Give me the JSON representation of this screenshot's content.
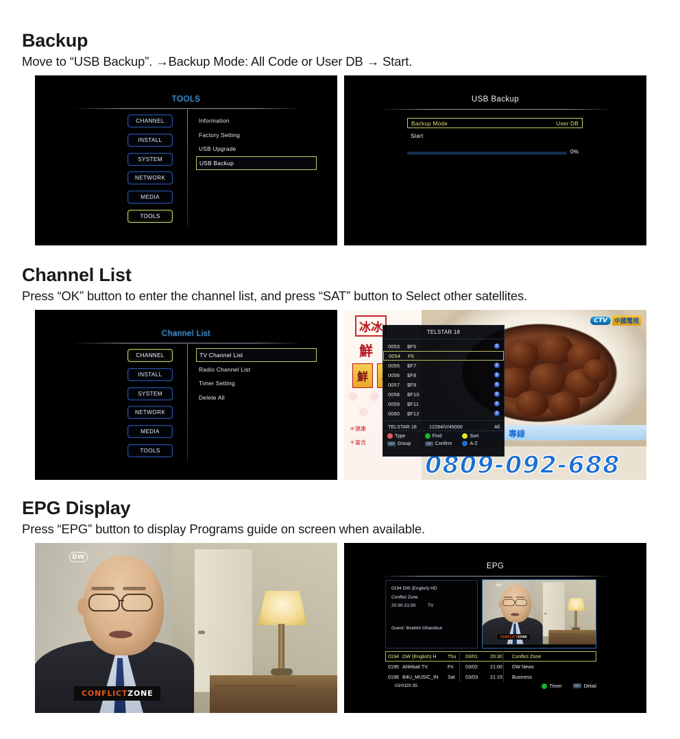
{
  "sections": [
    {
      "title": "Backup",
      "subtitle": "Move to “USB Backup”. →Backup Mode: All Code or User DB →  Start."
    },
    {
      "title": "Channel List",
      "subtitle": "Press “OK” button to enter the channel list, and press “SAT” button to Select other satellites."
    },
    {
      "title": "EPG Display",
      "subtitle": "Press “EPG” button to display Programs guide on screen when available."
    }
  ],
  "tools_menu": {
    "title": "TOOLS",
    "sidebar": [
      "CHANNEL",
      "INSTALL",
      "SYSTEM",
      "NETWORK",
      "MEDIA",
      "TOOLS"
    ],
    "selected_sidebar": "TOOLS",
    "options": [
      "Information",
      "Factory Setting",
      "USB Upgrade",
      "USB Backup"
    ],
    "selected_option": "USB Backup"
  },
  "usb_backup": {
    "title": "USB Backup",
    "mode_label": "Backup Mode",
    "mode_value": "User DB",
    "start_label": "Start",
    "progress_text": "0%",
    "progress_percent": 0
  },
  "channel_menu": {
    "title": "Channel List",
    "sidebar": [
      "CHANNEL",
      "INSTALL",
      "SYSTEM",
      "NETWORK",
      "MEDIA",
      "TOOLS"
    ],
    "selected_sidebar": "CHANNEL",
    "options": [
      "TV Channel List",
      "Radio Channel List",
      "Timer Setting",
      "Delete All"
    ],
    "selected_option": "TV Channel List"
  },
  "channel_list": {
    "header": "TELSTAR 18",
    "rows": [
      {
        "num": "0053",
        "name": "$F5",
        "locked": true,
        "selected": false
      },
      {
        "num": "0054",
        "name": "F6",
        "locked": false,
        "selected": true
      },
      {
        "num": "0055",
        "name": "$F7",
        "locked": true,
        "selected": false
      },
      {
        "num": "0056",
        "name": "$F8",
        "locked": true,
        "selected": false
      },
      {
        "num": "0057",
        "name": "$F9",
        "locked": true,
        "selected": false
      },
      {
        "num": "0058",
        "name": "$F10",
        "locked": true,
        "selected": false
      },
      {
        "num": "0059",
        "name": "$F11",
        "locked": true,
        "selected": false
      },
      {
        "num": "0060",
        "name": "$F12",
        "locked": true,
        "selected": false
      }
    ],
    "footer_satellite": "TELSTAR 18",
    "footer_tp": "12294/V/45000",
    "footer_filter": "All",
    "keys": [
      {
        "label": "Type",
        "color": "#e05a5a",
        "kind": "dot"
      },
      {
        "label": "Find",
        "color": "#19b429",
        "kind": "dot"
      },
      {
        "label": "Sort",
        "color": "#e8e421",
        "kind": "dot"
      },
      {
        "label": "Group",
        "color": "",
        "kind": "btn",
        "glyph": "SAT"
      },
      {
        "label": "Confirm",
        "color": "",
        "kind": "btn",
        "glyph": "OK"
      },
      {
        "label": "A-Z",
        "color": "#1f6fd0",
        "kind": "dot"
      }
    ]
  },
  "tv_background": {
    "channel_logo_left": "CTV",
    "channel_logo_right": "中國電視",
    "banner_top": "冰冰",
    "banner_mid": "鮮",
    "banner_box1": "鮮",
    "banner_box2": "梅",
    "bullet1": "＊健康",
    "bullet2": "＊富含",
    "hotline_label": "專線",
    "phone": "0809-092-688"
  },
  "dw_video": {
    "logo": "DW",
    "badge_part1": "CONFLICT",
    "badge_part2": "ZONE"
  },
  "epg": {
    "title": "EPG",
    "info": {
      "channel": "0194 DW (English) HD",
      "program": "Conflict Zone",
      "time": "20:30-21:00",
      "type": "TV",
      "guest": "Guest: Ibrahim Ghandour"
    },
    "rows": [
      {
        "num": "0194",
        "channel": "DW (English) H",
        "day": "Thu",
        "date": "03/01",
        "time": "20:30",
        "program": "Conflict Zone",
        "selected": true
      },
      {
        "num": "0195",
        "channel": "Ahlebait TV",
        "day": "Fri",
        "date": "03/02",
        "time": "21:00",
        "program": "DW News",
        "selected": false
      },
      {
        "num": "0196",
        "channel": "B4U_MUSIC_IN",
        "day": "Sat",
        "date": "03/03",
        "time": "21:15",
        "program": "Business",
        "selected": false
      }
    ],
    "footer_date": "03/01",
    "footer_time": "20:35",
    "keys": [
      {
        "label": "Timer",
        "color": "#19b429",
        "kind": "dot"
      },
      {
        "label": "Detail",
        "color": "",
        "kind": "btn",
        "glyph": "OK"
      }
    ]
  },
  "colors": {
    "accent_blue": "#4aa8ee",
    "accent_yellow": "#c9cd6b",
    "button_border": "#2b54a8",
    "selected_border": "#d4d86a"
  }
}
